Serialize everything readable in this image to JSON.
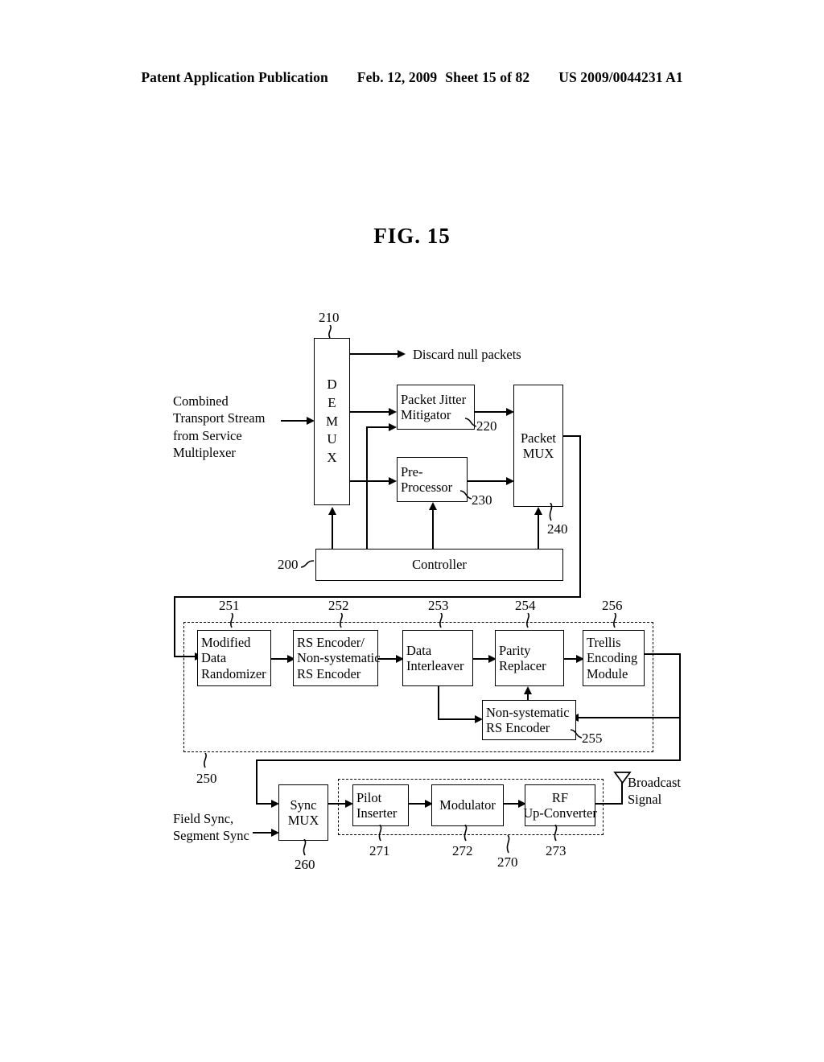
{
  "header": {
    "left": "Patent Application Publication",
    "date": "Feb. 12, 2009",
    "sheet": "Sheet 15 of 82",
    "docnum": "US 2009/0044231 A1"
  },
  "figure": {
    "title": "FIG. 15"
  },
  "labels": {
    "input_stream": [
      "Combined",
      "Transport Stream",
      "from Service",
      "Multiplexer"
    ],
    "discard": "Discard null packets",
    "sync_input": [
      "Field Sync,",
      "Segment Sync"
    ],
    "broadcast": [
      "Broadcast",
      "Signal"
    ]
  },
  "blocks": {
    "demux": {
      "letters": [
        "D",
        "E",
        "M",
        "U",
        "X"
      ],
      "ref": "210"
    },
    "packet_jitter_mitigator": {
      "lines": [
        "Packet Jitter",
        "Mitigator"
      ],
      "ref": "220"
    },
    "pre_processor": {
      "lines": [
        "Pre-",
        "Processor"
      ],
      "ref": "230"
    },
    "packet_mux": {
      "lines": [
        "Packet",
        "MUX"
      ],
      "ref": "240"
    },
    "controller": {
      "lines": [
        "Controller"
      ],
      "ref": "200"
    },
    "modified_data_randomizer": {
      "lines": [
        "Modified",
        "Data",
        "Randomizer"
      ],
      "ref": "251"
    },
    "rs_encoder": {
      "lines": [
        "RS Encoder/",
        "Non-systematic",
        "RS Encoder"
      ],
      "ref": "252"
    },
    "data_interleaver": {
      "lines": [
        "Data",
        "Interleaver"
      ],
      "ref": "253"
    },
    "parity_replacer": {
      "lines": [
        "Parity",
        "Replacer"
      ],
      "ref": "254"
    },
    "trellis_encoding_module": {
      "lines": [
        "Trellis",
        "Encoding",
        "Module"
      ],
      "ref": "256"
    },
    "non_systematic_rs_encoder": {
      "lines": [
        "Non-systematic",
        "RS Encoder"
      ],
      "ref": "255"
    },
    "sync_mux": {
      "lines": [
        "Sync",
        "MUX"
      ],
      "ref": "260"
    },
    "pilot_inserter": {
      "lines": [
        "Pilot",
        "Inserter"
      ],
      "ref": "271"
    },
    "modulator": {
      "lines": [
        "Modulator"
      ],
      "ref": "272"
    },
    "rf_up_converter": {
      "lines": [
        "RF",
        "Up-Converter"
      ],
      "ref": "273"
    }
  },
  "groups": {
    "encoder_group_ref": "250",
    "transmitter_group_ref": "270"
  }
}
